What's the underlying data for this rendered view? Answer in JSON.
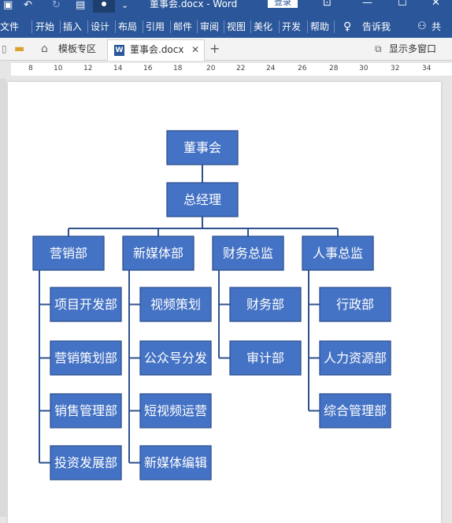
{
  "titlebar": {
    "doc_title": "董事会.docx - Word",
    "login_label": "登录"
  },
  "ribbon": {
    "tabs": [
      "文件",
      "开始",
      "插入",
      "设计",
      "布局",
      "引用",
      "邮件",
      "审阅",
      "视图",
      "美化",
      "开发",
      "帮助"
    ],
    "tell_me": "告诉我",
    "share": "共"
  },
  "doc_tabs": {
    "template_tab": "模板专区",
    "doc_tab": "董事会.docx",
    "multi_window": "显示多窗口"
  },
  "ruler": {
    "ticks": [
      "8",
      "10",
      "12",
      "14",
      "16",
      "18",
      "20",
      "22",
      "24",
      "26",
      "28",
      "30",
      "32",
      "34"
    ]
  },
  "org_chart": {
    "root": "董事会",
    "manager": "总经理",
    "departments": [
      {
        "name": "营销部",
        "children": [
          "项目开发部",
          "营销策划部",
          "销售管理部",
          "投资发展部"
        ]
      },
      {
        "name": "新媒体部",
        "children": [
          "视频策划",
          "公众号分发",
          "短视频运营",
          "新媒体编辑"
        ]
      },
      {
        "name": "财务总监",
        "children": [
          "财务部",
          "审计部"
        ]
      },
      {
        "name": "人事总监",
        "children": [
          "行政部",
          "人力资源部",
          "综合管理部"
        ]
      }
    ],
    "colors": {
      "box": "#4472c4",
      "border": "#2f528f",
      "text": "#ffffff",
      "line": "#2f528f"
    }
  }
}
